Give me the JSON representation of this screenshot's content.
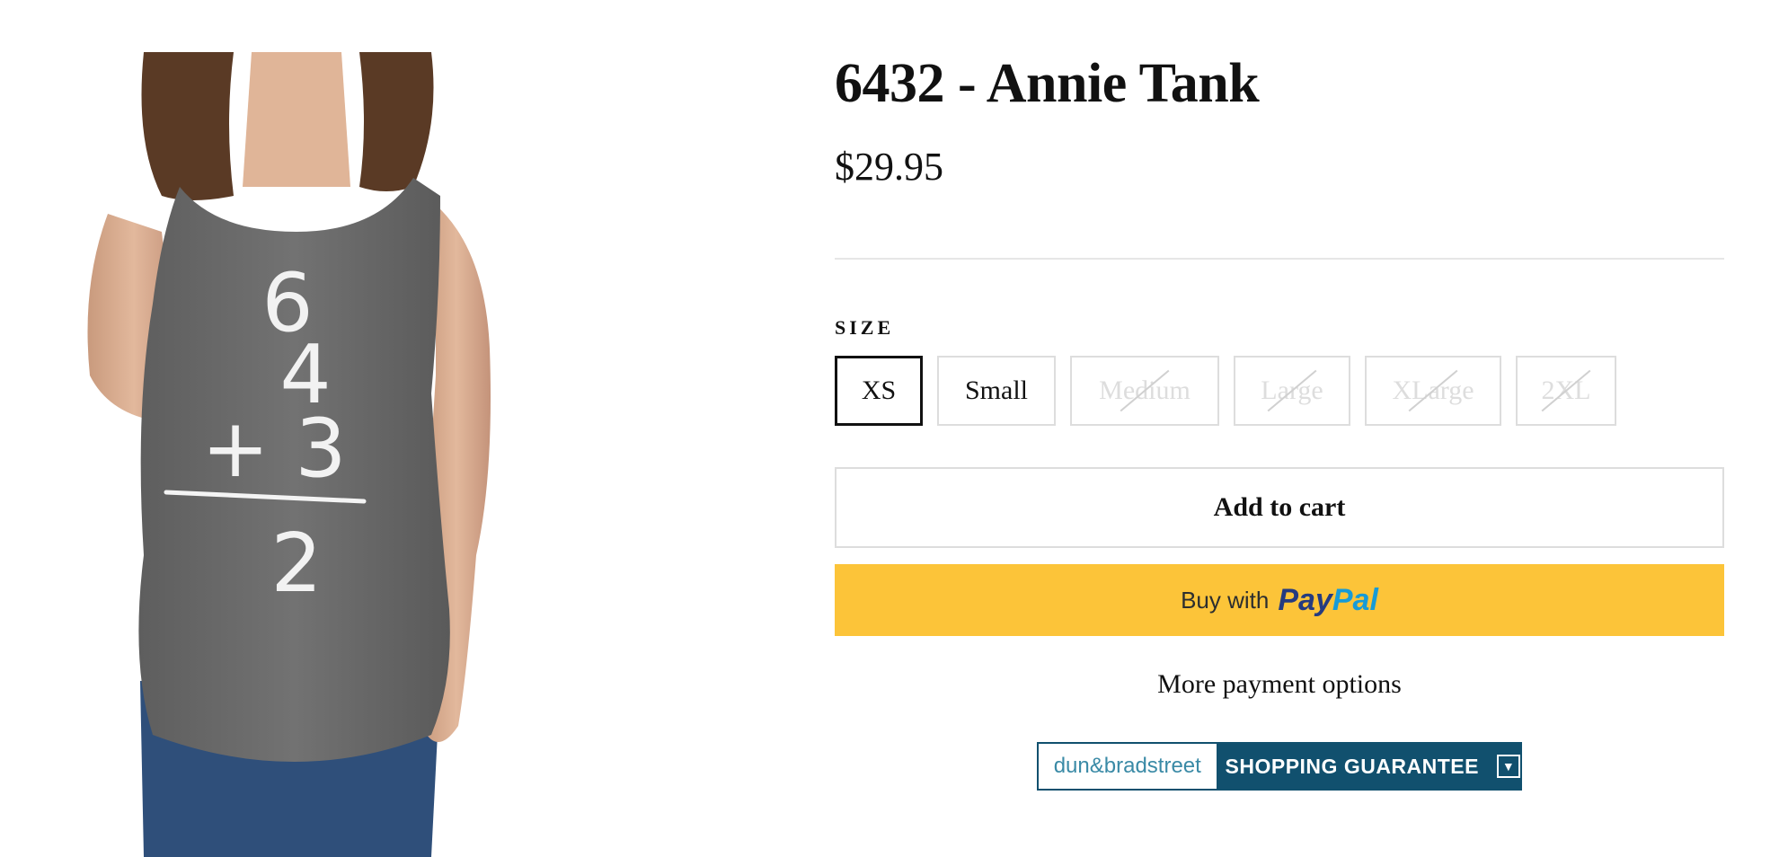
{
  "product": {
    "title": "6432 - Annie Tank",
    "price": "$29.95",
    "image_alt": "Gray tank top with handwritten 6 4 + 3 = 2"
  },
  "variants": {
    "label": "SIZE",
    "options": [
      {
        "label": "XS",
        "state": "selected"
      },
      {
        "label": "Small",
        "state": "available"
      },
      {
        "label": "Medium",
        "state": "sold-out"
      },
      {
        "label": "Large",
        "state": "sold-out"
      },
      {
        "label": "XLarge",
        "state": "sold-out"
      },
      {
        "label": "2XL",
        "state": "sold-out"
      }
    ]
  },
  "actions": {
    "add_to_cart": "Add to cart",
    "paypal_prefix": "Buy with",
    "paypal_brand_1": "Pay",
    "paypal_brand_2": "Pal",
    "more_payment": "More payment options"
  },
  "trust_badge": {
    "brand": "dun&bradstreet",
    "label": "SHOPPING GUARANTEE",
    "icon": "chevron-down-icon"
  },
  "shirt_text": {
    "line1": "6",
    "line2": "4",
    "line3": "+ 3",
    "line4": "2"
  },
  "colors": {
    "paypal_yellow": "#fcc439",
    "paypal_dark_blue": "#253b80",
    "paypal_light_blue": "#179bd7",
    "dnb_blue": "#11506e",
    "border_gray": "#dddddd"
  }
}
